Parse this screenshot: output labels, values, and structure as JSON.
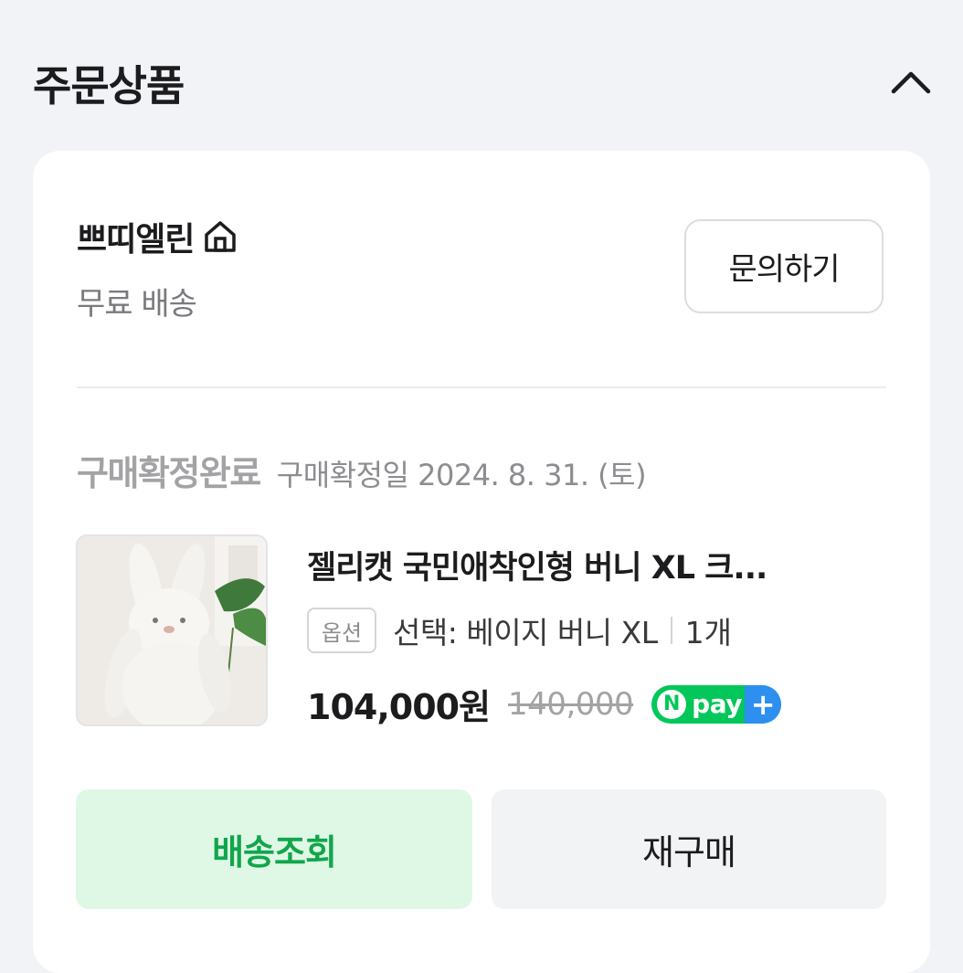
{
  "section": {
    "title": "주문상품",
    "collapse_icon": "chevron-up-icon"
  },
  "seller": {
    "name": "쁘띠엘린",
    "icon": "home-icon",
    "shipping": "무료 배송",
    "inquiry_label": "문의하기"
  },
  "order": {
    "status": "구매확정완료",
    "date_text": "구매확정일 2024. 8. 31. (토)"
  },
  "product": {
    "title": "젤리캣 국민애착인형 버니 XL 크...",
    "option_badge": "옵션",
    "option": "선택: 베이지 버니 XL",
    "quantity": "1개",
    "price": "104,000원",
    "original_price": "140,000",
    "npay_label": "pay"
  },
  "actions": {
    "track_label": "배송조회",
    "reorder_label": "재구매"
  },
  "colors": {
    "accent_green": "#12a64c",
    "track_bg": "#dff8e6",
    "npay_green": "#03c75a",
    "npay_blue": "#2d8ff0"
  }
}
